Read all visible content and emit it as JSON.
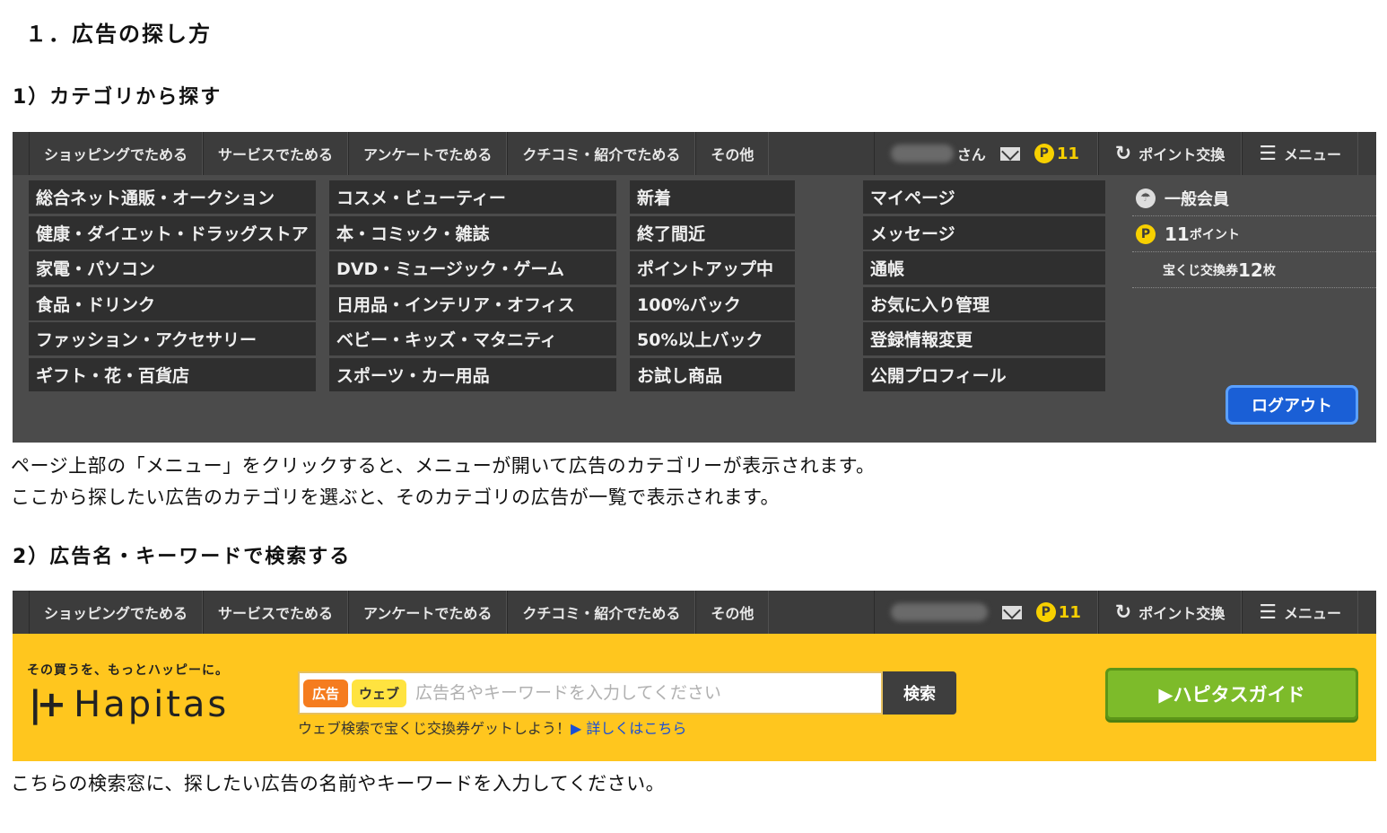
{
  "section_title": "１．広告の探し方",
  "step1": {
    "heading": "1）カテゴリから探す",
    "nav": {
      "items": [
        "ショッピングでためる",
        "サービスでためる",
        "アンケートでためる",
        "クチコミ・紹介でためる",
        "その他"
      ],
      "user_suffix": "さん",
      "points": "11",
      "exchange_label": "ポイント交換",
      "menu_label": "メニュー"
    },
    "categories": {
      "col1": [
        "総合ネット通販・オークション",
        "健康・ダイエット・ドラッグストア",
        "家電・パソコン",
        "食品・ドリンク",
        "ファッション・アクセサリー",
        "ギフト・花・百貨店"
      ],
      "col2": [
        "コスメ・ビューティー",
        "本・コミック・雑誌",
        "DVD・ミュージック・ゲーム",
        "日用品・インテリア・オフィス",
        "ベビー・キッズ・マタニティ",
        "スポーツ・カー用品"
      ],
      "col3": [
        "新着",
        "終了間近",
        "ポイントアップ中",
        "100%バック",
        "50%以上バック",
        "お試し商品"
      ],
      "col4": [
        "マイページ",
        "メッセージ",
        "通帳",
        "お気に入り管理",
        "登録情報変更",
        "公開プロフィール"
      ]
    },
    "member": {
      "rank": "一般会員",
      "points_num": "11",
      "points_unit": "ポイント",
      "lottery_label": "宝くじ交換券",
      "lottery_num": "12",
      "lottery_unit": "枚"
    },
    "logout_label": "ログアウト",
    "description": [
      "ページ上部の「メニュー」をクリックすると、メニューが開いて広告のカテゴリーが表示されます。",
      "ここから探したい広告のカテゴリを選ぶと、そのカテゴリの広告が一覧で表示されます。"
    ]
  },
  "step2": {
    "heading": "2）広告名・キーワードで検索する",
    "tagline": "その買うを、もっとハッピーに。",
    "logo_text": "Hapitas",
    "tag_ad": "広告",
    "tag_web": "ウェブ",
    "search_placeholder": "広告名やキーワードを入力してください",
    "search_button": "検索",
    "web_note": "ウェブ検索で宝くじ交換券ゲットしよう！",
    "web_note_link": "▶ 詳しくはこちら",
    "guide_button": "▶ハピタスガイド",
    "description": "こちらの検索窓に、探したい広告の名前やキーワードを入力してください。"
  },
  "colors": {
    "nav_bg": "#3c3c3c",
    "menu_bg": "#4b4b4b",
    "point_yellow": "#f7d000",
    "header_yellow": "#ffc61e",
    "logout_blue": "#1a5fd6",
    "guide_green": "#7dbb2a",
    "ad_orange": "#f57c1f"
  }
}
